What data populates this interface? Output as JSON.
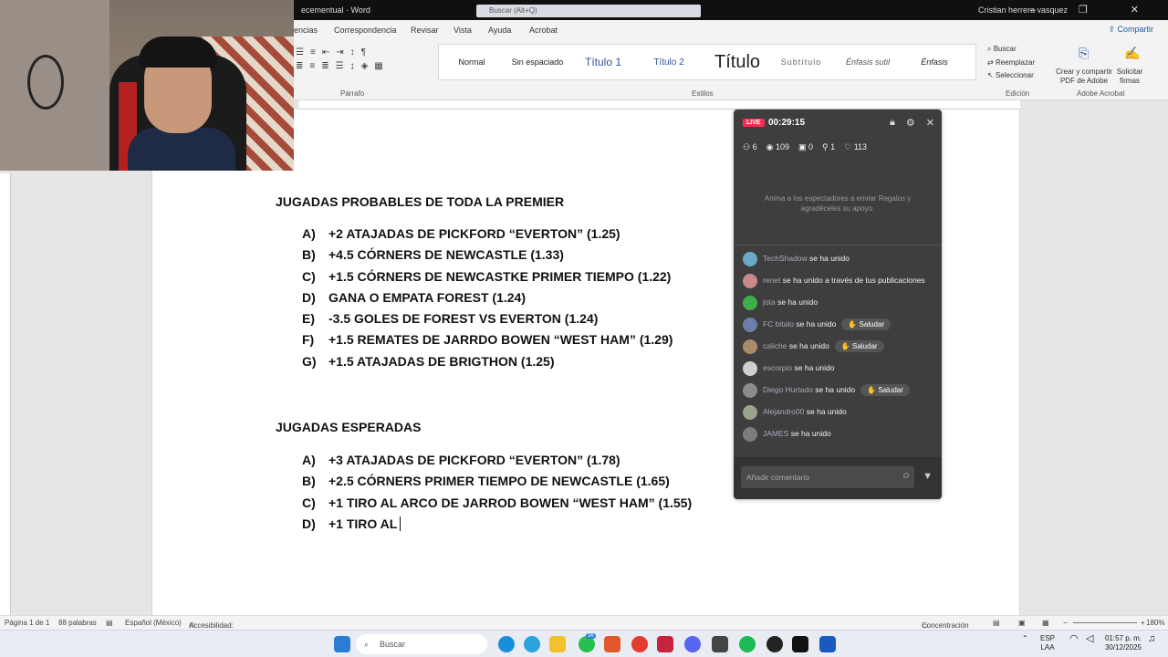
{
  "titlebar": {
    "doc": "ecementual  ·  Word",
    "search": "Buscar (Alt+Q)",
    "user": "Cristian herrera vasquez",
    "controls": "–  ❐  ✕"
  },
  "ribbon": {
    "tabs": [
      "encias",
      "Correspondencia",
      "Revisar",
      "Vista",
      "Ayuda",
      "Acrobat"
    ],
    "share": "Compartir",
    "parrafo": "Párrafo",
    "estilos": "Estilos",
    "edicion": "Edición",
    "adobe_group": "Adobe Acrobat",
    "styles": [
      "Normal",
      "Sin espaciado",
      "Título 1",
      "Título 2",
      "Título",
      "Subtítulo",
      "Énfasis sutil",
      "Énfasis"
    ],
    "edit": {
      "buscar": "Buscar",
      "reemplazar": "Reemplazar",
      "seleccionar": "Seleccionar"
    },
    "adobe": {
      "create": "Crear y compartir PDF de Adobe",
      "sign": "Solicitar firmas"
    }
  },
  "document": {
    "heading1": "JUGADAS PROBABLES DE TODA LA PREMIER",
    "list1": [
      {
        "letter": "A)",
        "text": "+2 ATAJADAS DE PICKFORD “EVERTON” (1.25)"
      },
      {
        "letter": "B)",
        "text": "+4.5 CÓRNERS DE NEWCASTLE (1.33)"
      },
      {
        "letter": "C)",
        "text": "+1.5 CÓRNERS DE NEWCASTKE PRIMER TIEMPO (1.22)"
      },
      {
        "letter": "D)",
        "text": "GANA O EMPATA FOREST (1.24)"
      },
      {
        "letter": "E)",
        "text": "-3.5 GOLES DE FOREST VS EVERTON (1.24)"
      },
      {
        "letter": "F)",
        "text": "+1.5 REMATES DE JARRDO BOWEN “WEST HAM” (1.29)"
      },
      {
        "letter": "G)",
        "text": "+1.5 ATAJADAS DE BRIGTHON (1.25)"
      }
    ],
    "heading2": "JUGADAS ESPERADAS",
    "list2": [
      {
        "letter": "A)",
        "text": "+3 ATAJADAS DE PICKFORD “EVERTON” (1.78)"
      },
      {
        "letter": "B)",
        "text": "+2.5 CÓRNERS PRIMER TIEMPO DE NEWCASTLE (1.65)"
      },
      {
        "letter": "C)",
        "text": "+1 TIRO AL ARCO DE JARROD BOWEN “WEST HAM” (1.55)"
      },
      {
        "letter": "D)",
        "text": "+1 TIRO AL"
      }
    ]
  },
  "live": {
    "badge": "LIVE",
    "timer": "00:29:15",
    "stats": {
      "viewers_now": "6",
      "views": "109",
      "gifts": "0",
      "joins": "1",
      "likes": "113"
    },
    "hint": "Anima a los espectadores a enviar Regalos y agradéceles su apoyo.",
    "greet_label": "Saludar",
    "events": [
      {
        "name": "TechShadow",
        "text": "se ha unido",
        "greet": false,
        "color": "#6aa9c9"
      },
      {
        "name": "renet",
        "text": "se ha unido a través de tus publicaciones",
        "greet": false,
        "color": "#c98a8a"
      },
      {
        "name": "jota",
        "text": "se ha unido",
        "greet": false,
        "color": "#3fae4b"
      },
      {
        "name": "FC bitalo",
        "text": "se ha unido",
        "greet": true,
        "color": "#6c7fa8"
      },
      {
        "name": "caliche",
        "text": "se ha unido",
        "greet": true,
        "color": "#a88c6c"
      },
      {
        "name": "escorpio",
        "text": "se ha unido",
        "greet": false,
        "color": "#cfcfcf"
      },
      {
        "name": "Diego Hurtado",
        "text": "se ha unido",
        "greet": true,
        "color": "#8c8c8c"
      },
      {
        "name": "Alejandro00",
        "text": "se ha unido",
        "greet": false,
        "color": "#9aa38c"
      },
      {
        "name": "JAMES",
        "text": "se ha unido",
        "greet": false,
        "color": "#7c7c7c"
      }
    ],
    "comment_placeholder": "Añadir comentario"
  },
  "statusbar": {
    "page": "Página 1 de 1",
    "words": "88 palabras",
    "language": "Español (México)",
    "accessibility": "Accesibilidad: todo correcto",
    "focus": "Concentración",
    "zoom": "180%"
  },
  "taskbar": {
    "search": "Buscar",
    "lang1": "ESP",
    "lang2": "LAA",
    "time": "01:57 p. m.",
    "date": "30/12/2025",
    "badge": "36"
  }
}
